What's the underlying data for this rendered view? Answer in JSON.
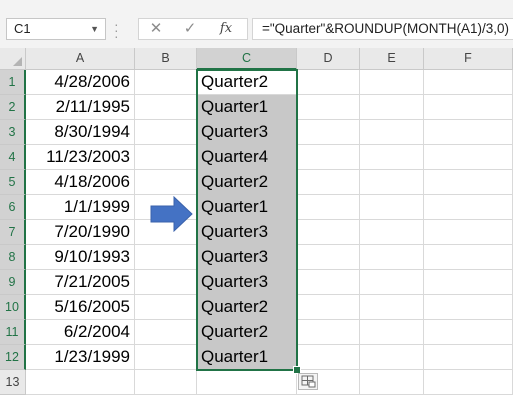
{
  "formula_bar": {
    "name_box": "C1",
    "name_box_dropdown_icon": "chevron-down-icon",
    "cancel_icon": "close-icon",
    "enter_icon": "check-icon",
    "function_label": "fx",
    "formula": "=\"Quarter\"&ROUNDUP(MONTH(A1)/3,0)"
  },
  "sheet": {
    "columns": [
      "A",
      "B",
      "C",
      "D",
      "E",
      "F"
    ],
    "selected_column": "C",
    "rows": [
      {
        "n": "1",
        "a": "4/28/2006",
        "c": "Quarter2"
      },
      {
        "n": "2",
        "a": "2/11/1995",
        "c": "Quarter1"
      },
      {
        "n": "3",
        "a": "8/30/1994",
        "c": "Quarter3"
      },
      {
        "n": "4",
        "a": "11/23/2003",
        "c": "Quarter4"
      },
      {
        "n": "5",
        "a": "4/18/2006",
        "c": "Quarter2"
      },
      {
        "n": "6",
        "a": "1/1/1999",
        "c": "Quarter1"
      },
      {
        "n": "7",
        "a": "7/20/1990",
        "c": "Quarter3"
      },
      {
        "n": "8",
        "a": "9/10/1993",
        "c": "Quarter3"
      },
      {
        "n": "9",
        "a": "7/21/2005",
        "c": "Quarter3"
      },
      {
        "n": "10",
        "a": "5/16/2005",
        "c": "Quarter2"
      },
      {
        "n": "11",
        "a": "6/2/2004",
        "c": "Quarter2"
      },
      {
        "n": "12",
        "a": "1/23/1999",
        "c": "Quarter1"
      },
      {
        "n": "13",
        "a": "",
        "c": ""
      }
    ],
    "selection_range": "C1:C12",
    "arrow_icon": "right-arrow-icon",
    "quick_analysis_icon": "quick-analysis-icon",
    "colors": {
      "accent": "#217346",
      "selection_fill": "#c8c8c8",
      "arrow": "#4472c4"
    }
  }
}
